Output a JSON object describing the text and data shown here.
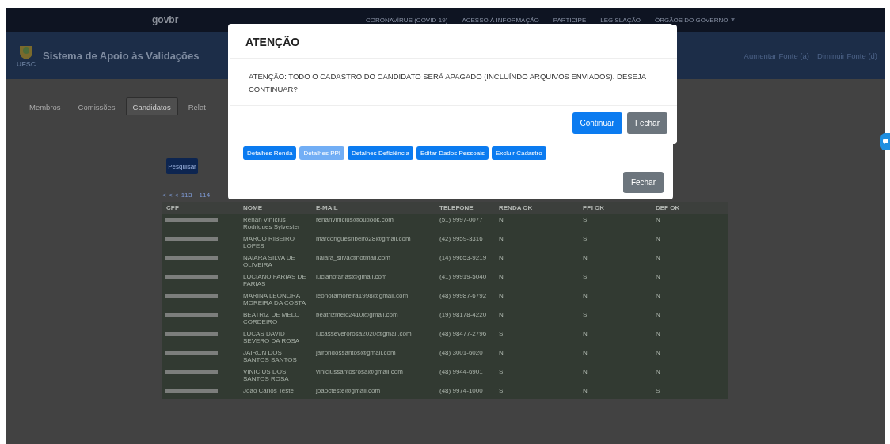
{
  "topbar": {
    "brand": "govbr",
    "links": [
      {
        "label": "CORONAVÍRUS (COVID-19)",
        "dropdown": false
      },
      {
        "label": "ACESSO À INFORMAÇÃO",
        "dropdown": false
      },
      {
        "label": "PARTICIPE",
        "dropdown": false
      },
      {
        "label": "LEGISLAÇÃO",
        "dropdown": false
      },
      {
        "label": "ÓRGÃOS DO GOVERNO",
        "dropdown": true
      }
    ]
  },
  "header": {
    "logo_text": "UFSC",
    "title": "Sistema de Apoio às Validações",
    "font_links": [
      "Aumentar Fonte (a)",
      "Diminuir Fonte (d)"
    ]
  },
  "tabs": [
    {
      "label": "Membros",
      "selected": false
    },
    {
      "label": "Comissões",
      "selected": false
    },
    {
      "label": "Candidatos",
      "selected": true
    },
    {
      "label": "Relat",
      "selected": false
    }
  ],
  "search_button": "Pesquisar",
  "pagination": "< < < 113 · 114",
  "table": {
    "columns": [
      "CPF",
      "NOME",
      "E-MAIL",
      "TELEFONE",
      "RENDA OK",
      "PPI OK",
      "DEF OK"
    ],
    "rows": [
      {
        "name": "Renan Vinícius Rodrigues Sylvester",
        "email": "renanvinicius@outlook.com",
        "phone": "(51) 9997-0077",
        "renda_ok": "N",
        "ppi_ok": "S",
        "def_ok": "N"
      },
      {
        "name": "MARCO RIBEIRO LOPES",
        "email": "marcoriguesribeiro28@gmail.com",
        "phone": "(42) 9959-3316",
        "renda_ok": "N",
        "ppi_ok": "S",
        "def_ok": "N"
      },
      {
        "name": "NAIARA SILVA DE OLIVEIRA",
        "email": "naiara_silva@hotmail.com",
        "phone": "(14) 99653-9219",
        "renda_ok": "N",
        "ppi_ok": "N",
        "def_ok": "N"
      },
      {
        "name": "LUCIANO FARIAS DE FARIAS",
        "email": "lucianofarias@gmail.com",
        "phone": "(41) 99919-5040",
        "renda_ok": "N",
        "ppi_ok": "S",
        "def_ok": "N"
      },
      {
        "name": "MARINA LEONORA MOREIRA DA COSTA",
        "email": "leonoramoreira1998@gmail.com",
        "phone": "(48) 99987-6792",
        "renda_ok": "N",
        "ppi_ok": "N",
        "def_ok": "N"
      },
      {
        "name": "BEATRIZ DE MELO CORDEIRO",
        "email": "beatrizmelo2410@gmail.com",
        "phone": "(19) 98178-4220",
        "renda_ok": "N",
        "ppi_ok": "S",
        "def_ok": "N"
      },
      {
        "name": "LUCAS DAVID SEVERO DA ROSA",
        "email": "lucasseverorosa2020@gmail.com",
        "phone": "(48) 98477-2796",
        "renda_ok": "S",
        "ppi_ok": "N",
        "def_ok": "N"
      },
      {
        "name": "JAIRON DOS SANTOS SANTOS",
        "email": "jairondossantos@gmail.com",
        "phone": "(48) 3001-6020",
        "renda_ok": "N",
        "ppi_ok": "N",
        "def_ok": "N"
      },
      {
        "name": "VINICIUS DOS SANTOS ROSA",
        "email": "viniciussantosrosa@gmail.com",
        "phone": "(48) 9944-6901",
        "renda_ok": "S",
        "ppi_ok": "N",
        "def_ok": "N"
      },
      {
        "name": "João Carlos Teste",
        "email": "joaocteste@gmail.com",
        "phone": "(48) 9974-1000",
        "renda_ok": "S",
        "ppi_ok": "N",
        "def_ok": "S"
      }
    ]
  },
  "details_dialog": {
    "buttons": [
      {
        "label": "Detalhes Renda",
        "disabled": false
      },
      {
        "label": "Detalhes PPI",
        "disabled": true
      },
      {
        "label": "Detalhes Deficiência",
        "disabled": false
      },
      {
        "label": "Editar Dados Pessoais",
        "disabled": false
      },
      {
        "label": "Excluir Cadastro",
        "disabled": false
      }
    ],
    "close_button": "Fechar"
  },
  "confirm_dialog": {
    "title": "ATENÇÃO",
    "message": "ATENÇÃO: TODO O CADASTRO DO CANDIDATO SERÁ APAGADO (INCLUÍNDO ARQUIVOS ENVIADOS). DESEJA CONTINUAR?",
    "confirm_button": "Continuar",
    "close_button": "Fechar"
  }
}
